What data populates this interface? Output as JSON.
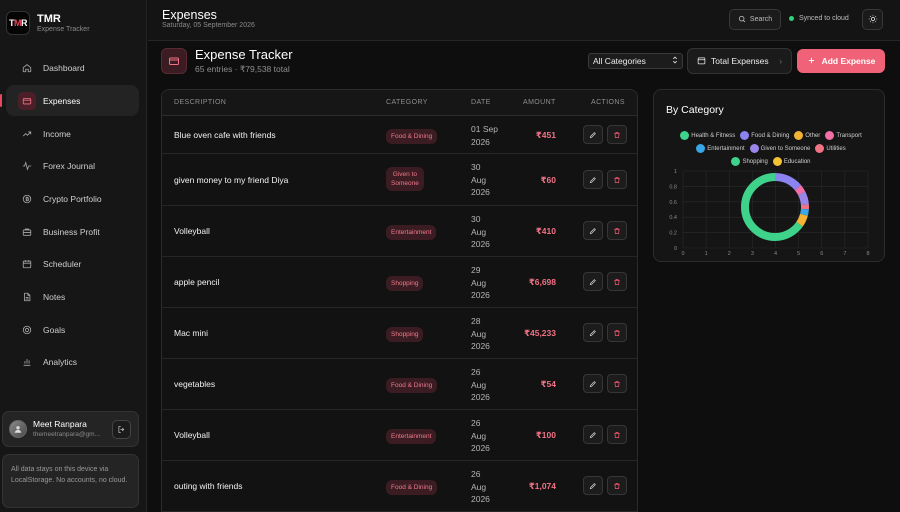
{
  "brand": {
    "logo_left": "T",
    "logo_mid": "M",
    "logo_right": "R",
    "name": "TMR",
    "subtitle": "Expense Tracker"
  },
  "nav": [
    {
      "label": "Dashboard",
      "icon": "home-icon",
      "active": false
    },
    {
      "label": "Expenses",
      "icon": "wallet-icon",
      "active": true
    },
    {
      "label": "Income",
      "icon": "trending-up-icon",
      "active": false
    },
    {
      "label": "Forex Journal",
      "icon": "pulse-icon",
      "active": false
    },
    {
      "label": "Crypto Portfolio",
      "icon": "bitcoin-icon",
      "active": false
    },
    {
      "label": "Business Profit",
      "icon": "briefcase-icon",
      "active": false
    },
    {
      "label": "Scheduler",
      "icon": "calendar-icon",
      "active": false
    },
    {
      "label": "Notes",
      "icon": "file-icon",
      "active": false
    },
    {
      "label": "Goals",
      "icon": "target-icon",
      "active": false
    },
    {
      "label": "Analytics",
      "icon": "bar-chart-icon",
      "active": false
    }
  ],
  "user": {
    "name": "Meet Ranpara",
    "email": "themeetranpara@gm..."
  },
  "storage_note": "All data stays on this device via LocalStorage. No accounts, no cloud.",
  "topbar": {
    "title": "Expenses",
    "date": "Saturday, 05 September 2026",
    "search_label": "Search",
    "sync_label": "Synced to cloud"
  },
  "header": {
    "title": "Expense Tracker",
    "subtitle": "65 entries · ₹79,538 total",
    "category_select": "All Categories",
    "total_button": "Total Expenses",
    "add_button": "Add Expense"
  },
  "colors": {
    "accent": "#f06277",
    "amount": "#f07285",
    "sync": "#2fd17a"
  },
  "table": {
    "headers": [
      "DESCRIPTION",
      "CATEGORY",
      "DATE",
      "AMOUNT",
      "ACTIONS"
    ],
    "rows": [
      {
        "description": "Blue oven cafe with friends",
        "category": "Food & Dining",
        "date": [
          "01 Sep",
          "2026"
        ],
        "amount": "₹451"
      },
      {
        "description": "given money to my friend Diya",
        "category": [
          "Given to",
          "Someone"
        ],
        "date": [
          "30",
          "Aug",
          "2026"
        ],
        "amount": "₹60"
      },
      {
        "description": "Volleyball",
        "category": "Entertainment",
        "date": [
          "30",
          "Aug",
          "2026"
        ],
        "amount": "₹410"
      },
      {
        "description": "apple pencil",
        "category": "Shopping",
        "date": [
          "29",
          "Aug",
          "2026"
        ],
        "amount": "₹6,698"
      },
      {
        "description": "Mac mini",
        "category": "Shopping",
        "date": [
          "28",
          "Aug",
          "2026"
        ],
        "amount": "₹45,233"
      },
      {
        "description": "vegetables",
        "category": "Food & Dining",
        "date": [
          "26",
          "Aug",
          "2026"
        ],
        "amount": "₹54"
      },
      {
        "description": "Volleyball",
        "category": "Entertainment",
        "date": [
          "26",
          "Aug",
          "2026"
        ],
        "amount": "₹100"
      },
      {
        "description": "outing with friends",
        "category": "Food & Dining",
        "date": [
          "26",
          "Aug",
          "2026"
        ],
        "amount": "₹1,074"
      }
    ]
  },
  "chart_data": {
    "type": "pie",
    "title": "By Category",
    "legend": [
      {
        "name": "Health & Fitness",
        "color": "#3fd28a"
      },
      {
        "name": "Food & Dining",
        "color": "#8b83f0"
      },
      {
        "name": "Other",
        "color": "#f2b233"
      },
      {
        "name": "Transport",
        "color": "#f06fa6"
      },
      {
        "name": "Entertainment",
        "color": "#3aa6e8"
      },
      {
        "name": "Given to Someone",
        "color": "#9a86e8"
      },
      {
        "name": "Utilities",
        "color": "#f07285"
      },
      {
        "name": "Shopping",
        "color": "#3fd28a"
      },
      {
        "name": "Education",
        "color": "#f2c233"
      }
    ],
    "slices": [
      {
        "name": "Shopping",
        "value": 65.3,
        "color": "#3fd28a"
      },
      {
        "name": "Food & Dining",
        "value": 13.8,
        "color": "#8b83f0"
      },
      {
        "name": "Transport",
        "value": 3.6,
        "color": "#f06fa6"
      },
      {
        "name": "Given to Someone",
        "value": 6.3,
        "color": "#9a86e8"
      },
      {
        "name": "Utilities",
        "value": 2.4,
        "color": "#f07285"
      },
      {
        "name": "Entertainment",
        "value": 3.1,
        "color": "#3aa6e8"
      },
      {
        "name": "Other",
        "value": 5.5,
        "color": "#f2b233"
      }
    ],
    "x_ticks": [
      "0",
      "1",
      "2",
      "3",
      "4",
      "5",
      "6",
      "7",
      "8"
    ],
    "y_ticks": [
      "1",
      "0.8",
      "0.6",
      "0.4",
      "0.2",
      "0"
    ],
    "grid": true
  }
}
